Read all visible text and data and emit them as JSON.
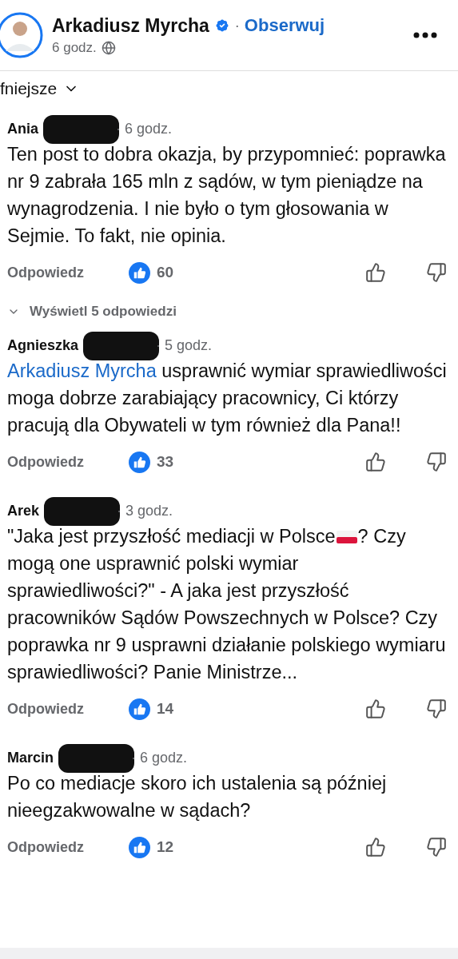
{
  "post_header": {
    "author": "Arkadiusz Myrcha",
    "verified": true,
    "separator": "·",
    "follow": "Obserwuj",
    "time": "6 godz."
  },
  "sort": {
    "label": "fniejsze"
  },
  "comments": [
    {
      "author": "Ania",
      "time": "· 6 godz.",
      "redacted": true,
      "body": [
        {
          "kind": "text",
          "text": "Ten post to dobra okazja, by przypomnieć: poprawka nr 9 zabrała 165 mln z sądów, w tym pieniądze na wynagrodzenia. I nie było o tym głosowania w Sejmie. To fakt, nie opinia."
        }
      ],
      "reply": "Odpowiedz",
      "likes": "60",
      "replies_link": "Wyświetl 5 odpowiedzi"
    },
    {
      "author": "Agnieszka",
      "time": "· 5 godz.",
      "redacted": true,
      "body": [
        {
          "kind": "mention",
          "text": "Arkadiusz Myrcha"
        },
        {
          "kind": "text",
          "text": " usprawnić wymiar sprawiedliwości moga dobrze zarabiający pracownicy, Ci którzy pracują dla Obywateli w tym również dla Pana!!"
        }
      ],
      "reply": "Odpowiedz",
      "likes": "33"
    },
    {
      "author": "Arek",
      "time": "· 3 godz.",
      "redacted": true,
      "body": [
        {
          "kind": "text",
          "text": "\"Jaka jest przyszłość mediacji w Polsce"
        },
        {
          "kind": "flag"
        },
        {
          "kind": "text",
          "text": "? Czy mogą one usprawnić polski wymiar sprawiedliwości?\" - A jaka jest przyszłość pracowników Sądów Powszechnych w Polsce? Czy poprawka nr 9 usprawni działanie polskiego wymiaru sprawiedliwości? Panie Ministrze..."
        }
      ],
      "reply": "Odpowiedz",
      "likes": "14"
    },
    {
      "author": "Marcin",
      "time": "· 6 godz.",
      "redacted": true,
      "body": [
        {
          "kind": "text",
          "text": "Po co mediacje skoro ich ustalenia są później nieegzakwowalne w sądach?"
        }
      ],
      "reply": "Odpowiedz",
      "likes": "12"
    }
  ]
}
